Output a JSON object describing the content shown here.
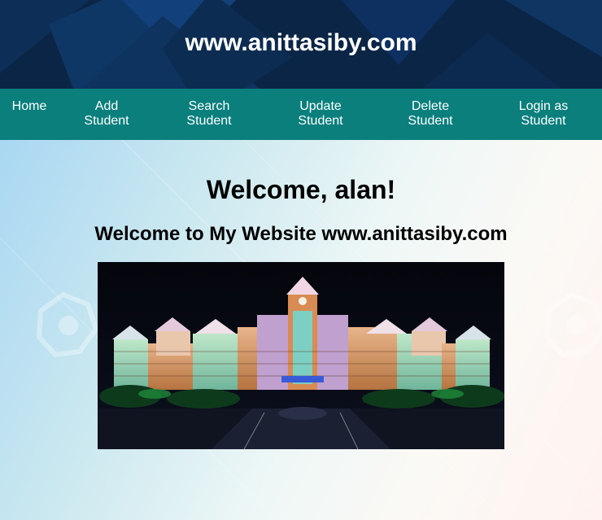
{
  "header": {
    "title": "www.anittasiby.com"
  },
  "nav": {
    "items": [
      {
        "label": "Home"
      },
      {
        "label": "Add\nStudent"
      },
      {
        "label": "Search\nStudent"
      },
      {
        "label": "Update\nStudent"
      },
      {
        "label": "Delete\nStudent"
      },
      {
        "label": "Login as\nStudent"
      }
    ]
  },
  "main": {
    "heading": "Welcome, alan!",
    "subheading": "Welcome to My Website www.anittasiby.com"
  },
  "colors": {
    "header_bg": "#0b2546",
    "nav_bg": "#0a7f7c",
    "text_on_dark": "#ffffff"
  }
}
